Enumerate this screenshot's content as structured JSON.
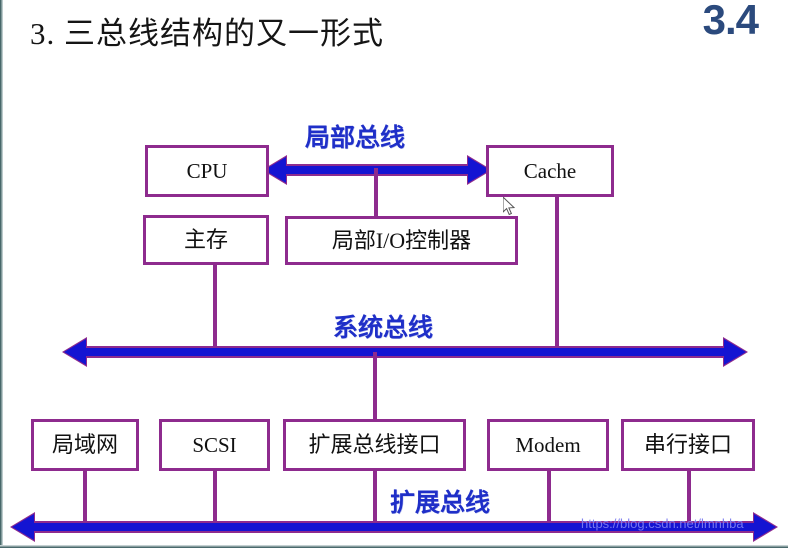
{
  "slide": {
    "title": "3. 三总线结构的又一形式",
    "number": "3.4",
    "watermark": "https://blog.csdn.net/lmnhba"
  },
  "diagram": {
    "boxes": [
      {
        "id": "cpu",
        "label": "CPU"
      },
      {
        "id": "cache",
        "label": "Cache"
      },
      {
        "id": "main-memory",
        "label": "主存"
      },
      {
        "id": "local-io-ctrl",
        "label": "局部I/O控制器"
      },
      {
        "id": "lan",
        "label": "局域网"
      },
      {
        "id": "scsi",
        "label": "SCSI"
      },
      {
        "id": "expansion-bus-interface",
        "label": "扩展总线接口"
      },
      {
        "id": "modem",
        "label": "Modem"
      },
      {
        "id": "serial-port",
        "label": "串行接口"
      }
    ],
    "buses": [
      {
        "id": "local-bus",
        "label": "局部总线"
      },
      {
        "id": "system-bus",
        "label": "系统总线"
      },
      {
        "id": "expansion-bus",
        "label": "扩展总线"
      }
    ]
  },
  "colors": {
    "box_border": "#8e2b8e",
    "bus_fill": "#1414d2",
    "bus_outline": "#8e2b8e",
    "bus_label": "#1f2fc8",
    "slide_number": "#2b4a7d",
    "title": "#151515"
  }
}
